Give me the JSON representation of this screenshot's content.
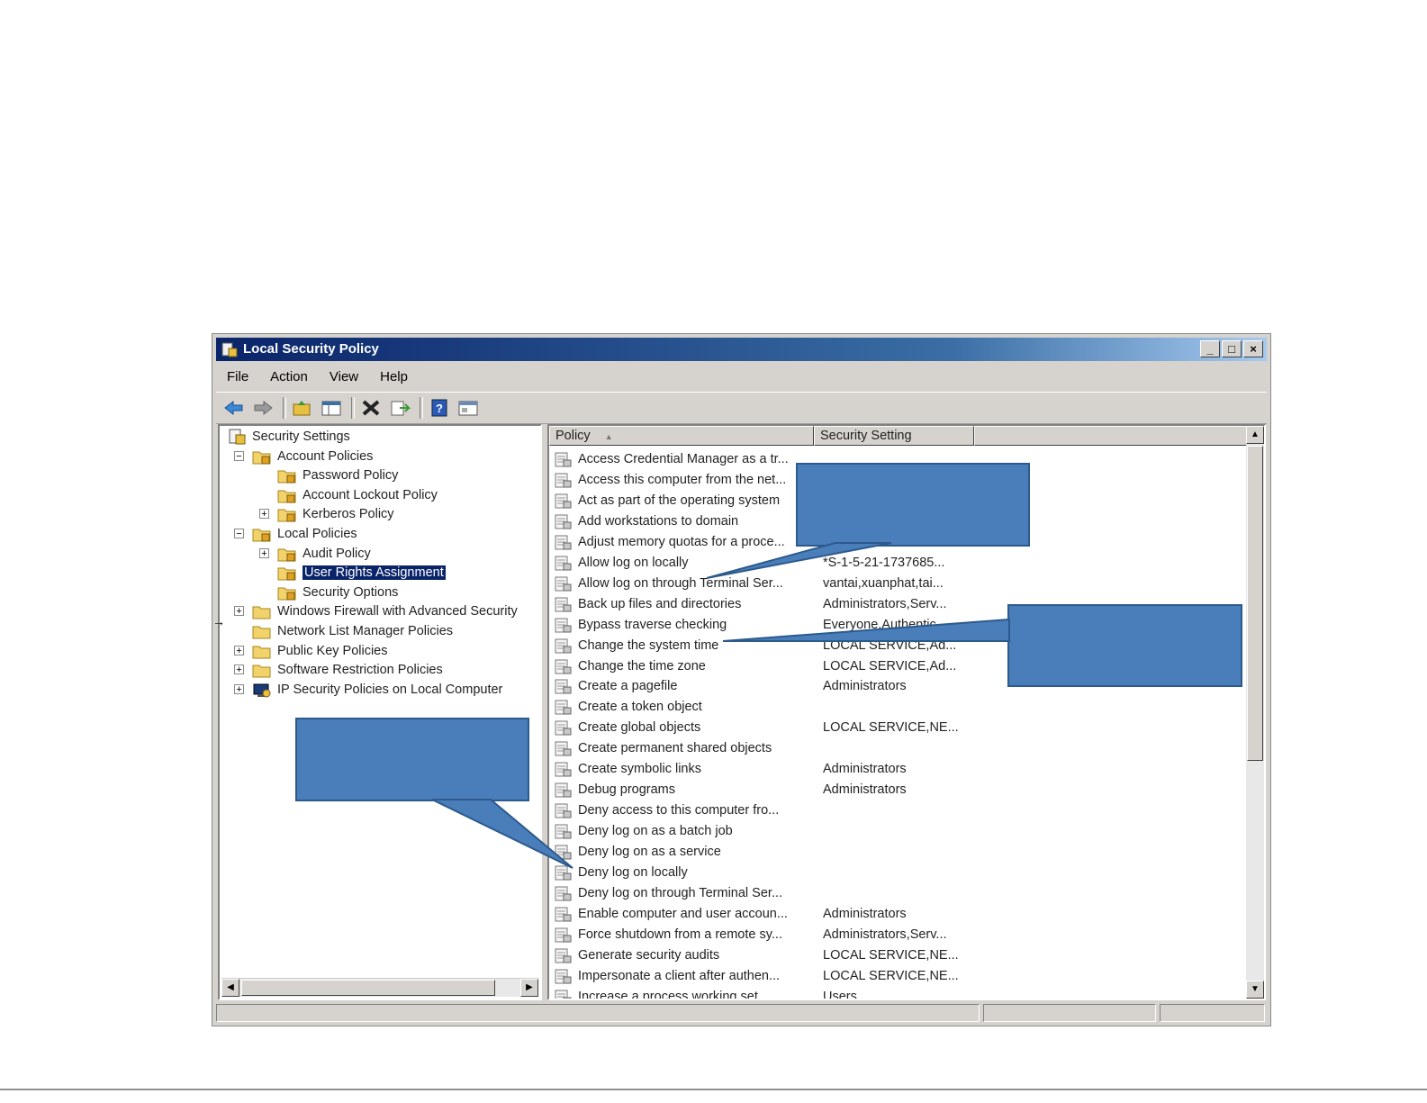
{
  "window": {
    "title": "Local Security Policy",
    "controls": [
      "_",
      "□",
      "×"
    ]
  },
  "menu": [
    "File",
    "Action",
    "View",
    "Help"
  ],
  "toolbar": [
    "back-arrow-icon",
    "forward-arrow-icon",
    "up-folder-icon",
    "show-hide-tree-icon",
    "delete-icon",
    "export-list-icon",
    "help-icon",
    "properties-icon"
  ],
  "tree": [
    {
      "label": "Security Settings",
      "level": 0,
      "expander": "",
      "icon": "security-settings-icon"
    },
    {
      "label": "Account Policies",
      "level": 1,
      "expander": "−",
      "icon": "folder-policy-icon"
    },
    {
      "label": "Password Policy",
      "level": 2,
      "expander": "",
      "icon": "folder-policy-icon"
    },
    {
      "label": "Account Lockout Policy",
      "level": 2,
      "expander": "",
      "icon": "folder-policy-icon"
    },
    {
      "label": "Kerberos Policy",
      "level": 2,
      "expander": "+",
      "icon": "folder-policy-icon"
    },
    {
      "label": "Local Policies",
      "level": 1,
      "expander": "−",
      "icon": "folder-policy-icon"
    },
    {
      "label": "Audit Policy",
      "level": 2,
      "expander": "+",
      "icon": "folder-policy-icon"
    },
    {
      "label": "User Rights Assignment",
      "level": 2,
      "expander": "",
      "icon": "folder-policy-icon",
      "selected": true
    },
    {
      "label": "Security Options",
      "level": 2,
      "expander": "",
      "icon": "folder-policy-icon"
    },
    {
      "label": "Windows Firewall with Advanced Security",
      "level": 1,
      "expander": "+",
      "icon": "folder-icon"
    },
    {
      "label": "Network List Manager Policies",
      "level": 1,
      "expander": "",
      "icon": "folder-icon"
    },
    {
      "label": "Public Key Policies",
      "level": 1,
      "expander": "+",
      "icon": "folder-icon"
    },
    {
      "label": "Software Restriction Policies",
      "level": 1,
      "expander": "+",
      "icon": "folder-icon"
    },
    {
      "label": "IP Security Policies on Local Computer",
      "level": 1,
      "expander": "+",
      "icon": "ip-security-icon"
    }
  ],
  "list": {
    "columns": [
      "Policy",
      "Security Setting"
    ],
    "sort_indicator": "▲",
    "rows": [
      {
        "policy": "Access Credential Manager as a tr...",
        "setting": ""
      },
      {
        "policy": "Access this computer from the net...",
        "setting": ""
      },
      {
        "policy": "Act as part of the operating system",
        "setting": ""
      },
      {
        "policy": "Add workstations to domain",
        "setting": ""
      },
      {
        "policy": "Adjust memory quotas for a proce...",
        "setting": ""
      },
      {
        "policy": "Allow log on locally",
        "setting": "*S-1-5-21-1737685..."
      },
      {
        "policy": "Allow log on through Terminal Ser...",
        "setting": "vantai,xuanphat,tai..."
      },
      {
        "policy": "Back up files and directories",
        "setting": "Administrators,Serv..."
      },
      {
        "policy": "Bypass traverse checking",
        "setting": "Everyone,Authentic..."
      },
      {
        "policy": "Change the system time",
        "setting": "LOCAL SERVICE,Ad..."
      },
      {
        "policy": "Change the time zone",
        "setting": "LOCAL SERVICE,Ad..."
      },
      {
        "policy": "Create a pagefile",
        "setting": "Administrators"
      },
      {
        "policy": "Create a token object",
        "setting": ""
      },
      {
        "policy": "Create global objects",
        "setting": "LOCAL SERVICE,NE..."
      },
      {
        "policy": "Create permanent shared objects",
        "setting": ""
      },
      {
        "policy": "Create symbolic links",
        "setting": "Administrators"
      },
      {
        "policy": "Debug programs",
        "setting": "Administrators"
      },
      {
        "policy": "Deny access to this computer fro...",
        "setting": ""
      },
      {
        "policy": "Deny log on as a batch job",
        "setting": ""
      },
      {
        "policy": "Deny log on as a service",
        "setting": ""
      },
      {
        "policy": "Deny log on locally",
        "setting": ""
      },
      {
        "policy": "Deny log on through Terminal Ser...",
        "setting": ""
      },
      {
        "policy": "Enable computer and user accoun...",
        "setting": "Administrators"
      },
      {
        "policy": "Force shutdown from a remote sy...",
        "setting": "Administrators,Serv..."
      },
      {
        "policy": "Generate security audits",
        "setting": "LOCAL SERVICE,NE..."
      },
      {
        "policy": "Impersonate a client after authen...",
        "setting": "LOCAL SERVICE,NE..."
      },
      {
        "policy": "Increase a process working set",
        "setting": "Users"
      }
    ]
  },
  "colors": {
    "callout_fill": "#4a7ebb",
    "title_bar": "#0a246a",
    "selection": "#0a246a"
  }
}
